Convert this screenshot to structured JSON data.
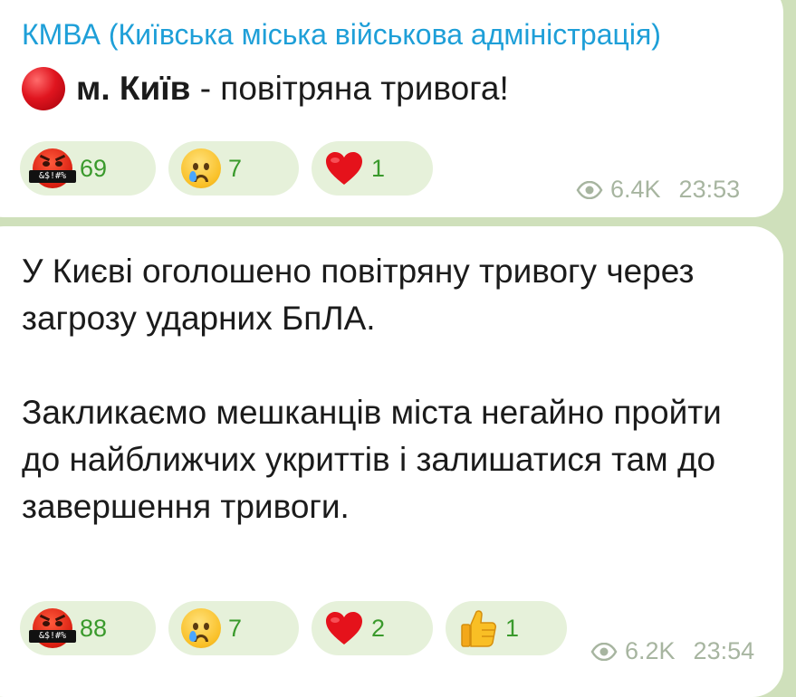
{
  "channel": {
    "title": "КМВА (Київська міська військова адміністрація)"
  },
  "messages": [
    {
      "bullet_icon": "red-circle",
      "city": "м. Київ",
      "text": " - повітряна тривога!",
      "reactions": [
        {
          "emoji": "face-with-symbols-on-mouth",
          "count": "69"
        },
        {
          "emoji": "crying-face",
          "count": "7"
        },
        {
          "emoji": "red-heart",
          "count": "1"
        }
      ],
      "views": "6.4K",
      "time": "23:53"
    },
    {
      "paragraph1": "У Києві оголошено повітряну тривогу через загрозу ударних БпЛА.",
      "paragraph2": "Закликаємо мешканців міста негайно пройти до найближчих укриттів і залишатися там до завершення тривоги.",
      "reactions": [
        {
          "emoji": "face-with-symbols-on-mouth",
          "count": "88"
        },
        {
          "emoji": "crying-face",
          "count": "7"
        },
        {
          "emoji": "red-heart",
          "count": "2"
        },
        {
          "emoji": "thumbs-up",
          "count": "1"
        }
      ],
      "views": "6.2K",
      "time": "23:54"
    }
  ],
  "colors": {
    "accent": "#1e9fd8",
    "chat_background": "#cfe0bb",
    "reaction_background": "#e6f1da",
    "reaction_count": "#3a9a2c",
    "meta": "#a7b5a0"
  }
}
